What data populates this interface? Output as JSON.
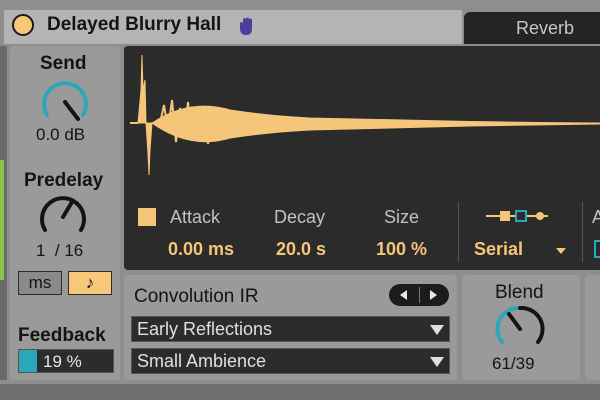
{
  "device": {
    "title": "Delayed Blurry Hall",
    "tab_label": "Reverb"
  },
  "left": {
    "send_label": "Send",
    "send_value": "0.0 dB",
    "predelay_label": "Predelay",
    "predelay_value": "1  / 16",
    "ms_button": "ms",
    "note_button": "♪",
    "feedback_label": "Feedback",
    "feedback_value": "19 %",
    "feedback_fraction": 0.19
  },
  "main": {
    "attack_label": "Attack",
    "attack_value": "0.00 ms",
    "decay_label": "Decay",
    "decay_value": "20.0 s",
    "size_label": "Size",
    "size_value": "100 %",
    "routing_value": "Serial",
    "cut_label": "A"
  },
  "ir": {
    "label": "Convolution IR",
    "category": "Early Reflections",
    "preset": "Small Ambience"
  },
  "blend": {
    "label": "Blend",
    "value": "61/39"
  },
  "colors": {
    "accent": "#f5c57a",
    "teal": "#2aa7b8",
    "panel": "#9a9a9a",
    "display": "#2b2b2b"
  },
  "icons": [
    "power-icon",
    "hand-icon",
    "routing-icon",
    "triangle-left-icon",
    "triangle-right-icon",
    "chevron-down-icon"
  ]
}
